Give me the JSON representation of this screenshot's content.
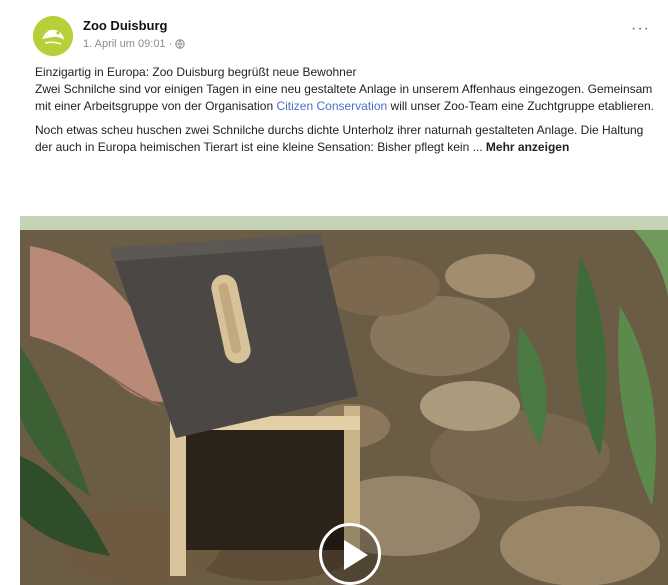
{
  "post": {
    "page_name": "Zoo Duisburg",
    "timestamp": "1. April um 09:01",
    "separator": "·",
    "more_icon": "more-horizontal-icon",
    "avatar_icon": "zoo-duisburg-logo",
    "paragraph1": {
      "line1": "Einzigartig in Europa: Zoo Duisburg begrüßt neue Bewohner",
      "line2": "Zwei Schnilche sind vor einigen Tagen in eine neu gestaltete Anlage in unserem Affenhaus eingezogen. Gemeinsam mit einer Arbeitsgruppe von der Organisation ",
      "link": "Citizen Conservation",
      "line3": " will unser Zoo-Team eine Zuchtgruppe etablieren."
    },
    "paragraph2": {
      "text": "Noch etwas scheu huschen zwei Schnilche durchs dichte Unterholz ihrer naturnah gestalteten Anlage. Die Haltung der auch in Europa heimischen Tierart ist eine kleine Sensation: Bisher pflegt kein ... ",
      "more": "Mehr anzeigen"
    },
    "video": {
      "play_icon": "play-icon"
    }
  },
  "colors": {
    "avatar_bg": "#b8cf3a",
    "link": "#4b6fc7",
    "meta": "#8a8d91"
  }
}
